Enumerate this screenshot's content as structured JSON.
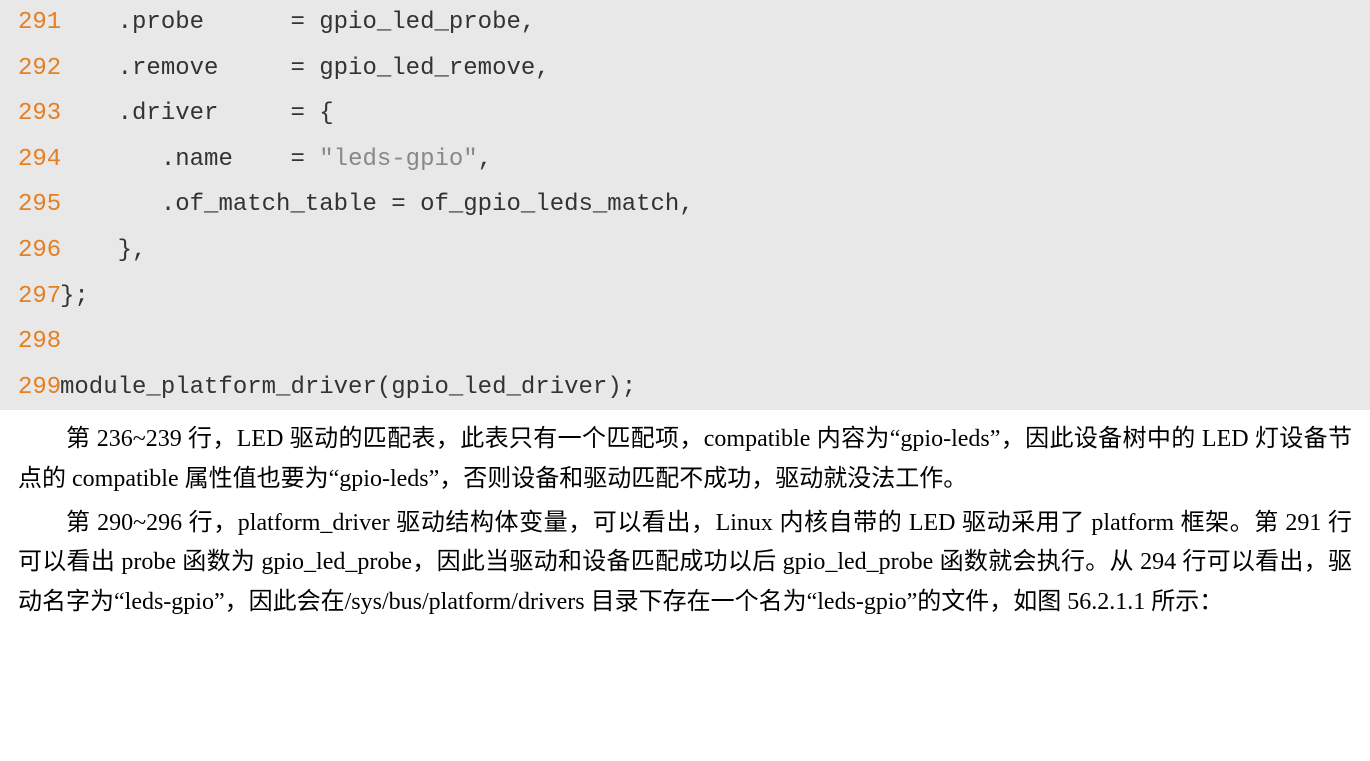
{
  "code": {
    "lines": [
      {
        "num": "291",
        "indent": "    ",
        "text_before": ".probe      ",
        "op": "=",
        "text_after": " gpio_led_probe",
        "end": ","
      },
      {
        "num": "292",
        "indent": "    ",
        "text_before": ".remove     ",
        "op": "=",
        "text_after": " gpio_led_remove",
        "end": ","
      },
      {
        "num": "293",
        "indent": "    ",
        "text_before": ".driver     ",
        "op": "=",
        "text_after": " ",
        "end": "{"
      },
      {
        "num": "294",
        "indent": "       ",
        "text_before": ".name    ",
        "op": "=",
        "text_after": " ",
        "string": "\"leds-gpio\"",
        "end": ","
      },
      {
        "num": "295",
        "indent": "       ",
        "text_before": ".of_match_table ",
        "op": "=",
        "text_after": " of_gpio_leds_match",
        "end": ","
      },
      {
        "num": "296",
        "indent": "    ",
        "text_before": "",
        "op": "",
        "text_after": "",
        "end": "},"
      },
      {
        "num": "297",
        "indent": "",
        "text_before": "",
        "op": "",
        "text_after": "",
        "end": "};"
      },
      {
        "num": "298",
        "indent": "",
        "text_before": "",
        "op": "",
        "text_after": "",
        "end": ""
      },
      {
        "num": "299",
        "indent": "",
        "text_before": "module_platform_driver",
        "op": "(",
        "text_after": "gpio_led_driver",
        "end": ");"
      }
    ]
  },
  "prose": {
    "p1": "第 236~239 行，LED 驱动的匹配表，此表只有一个匹配项，compatible 内容为“gpio-leds”，因此设备树中的 LED 灯设备节点的 compatible 属性值也要为“gpio-leds”，否则设备和驱动匹配不成功，驱动就没法工作。",
    "p2": "第 290~296 行，platform_driver 驱动结构体变量，可以看出，Linux 内核自带的 LED 驱动采用了 platform 框架。第 291 行可以看出 probe 函数为 gpio_led_probe，因此当驱动和设备匹配成功以后 gpio_led_probe 函数就会执行。从 294 行可以看出，驱动名字为“leds-gpio”，因此会在/sys/bus/platform/drivers 目录下存在一个名为“leds-gpio”的文件，如图 56.2.1.1 所示："
  }
}
